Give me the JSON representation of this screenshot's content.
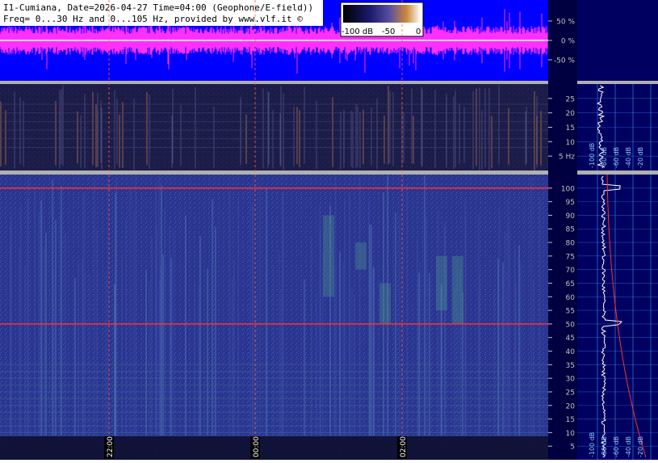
{
  "header": {
    "line1": "I1-Cumiana, Date=2026-04-27 Time=04:00 (Geophone/E-field))",
    "line2": "Freq= 0...30 Hz and 0...105 Hz, provided by www.vlf.it ©"
  },
  "colorbar": {
    "labels": [
      "-100 dB",
      "-50",
      "0"
    ],
    "stops": [
      "#000000",
      "#1a1a6e",
      "#5a4fa0",
      "#c98a3a",
      "#ffffff"
    ]
  },
  "colors": {
    "amplitude_bg": "#0000ff",
    "amplitude_signal": "#ff30ff",
    "spectrogram_bg": "#2a3590",
    "side_panel_bg": "#000060",
    "side_grid": "#3aa0ff",
    "marker_line": "#ff6040",
    "mains_line": "#ff3030"
  },
  "chart_data": [
    {
      "type": "line",
      "name": "amplitude",
      "y_ticks": [
        50,
        0,
        -50
      ],
      "y_tick_labels": [
        "50 %",
        "0 %",
        "-50 %"
      ],
      "ylim": [
        -100,
        100
      ]
    },
    {
      "type": "heatmap",
      "name": "spectrogram-low",
      "y_ticks": [
        5,
        10,
        15,
        20,
        25
      ],
      "y_tick_labels": [
        "5 Hz",
        "10",
        "15",
        "20",
        "25"
      ],
      "ylim": [
        0,
        30
      ]
    },
    {
      "type": "heatmap",
      "name": "spectrogram-high",
      "y_ticks": [
        5,
        10,
        15,
        20,
        25,
        30,
        35,
        40,
        45,
        50,
        55,
        60,
        65,
        70,
        75,
        80,
        85,
        90,
        95,
        100
      ],
      "y_tick_labels": [
        "5",
        "10",
        "15",
        "20",
        "25",
        "30",
        "35",
        "40",
        "45",
        "50",
        "55",
        "60",
        "65",
        "70",
        "75",
        "80",
        "85",
        "90",
        "95",
        "100"
      ],
      "ylim": [
        0,
        105
      ],
      "mains_hz": [
        50,
        100
      ]
    },
    {
      "type": "line",
      "name": "average-spectrum",
      "x_ticks": [
        "-100 dB",
        "-80 dB",
        "-60 dB",
        "-40 dB",
        "-20 dB"
      ]
    }
  ],
  "time_axis": {
    "labels": [
      "22:00",
      "00:00",
      "02:00"
    ]
  }
}
